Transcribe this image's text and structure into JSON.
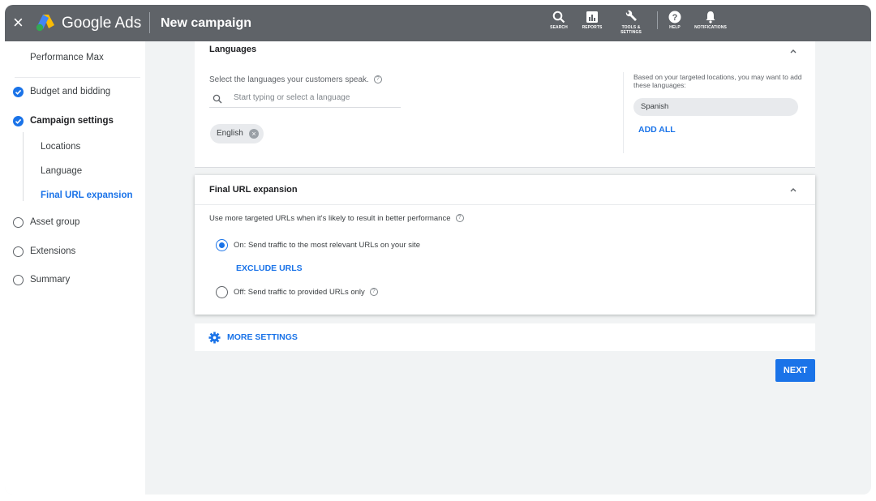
{
  "header": {
    "close_glyph": "×",
    "brand": "Google Ads",
    "title": "New campaign",
    "tools": [
      {
        "label": "SEARCH",
        "icon": "search-icon"
      },
      {
        "label": "REPORTS",
        "icon": "reports-icon"
      },
      {
        "label": "TOOLS &",
        "label2": "SETTINGS",
        "icon": "wrench-icon"
      },
      {
        "label": "HELP",
        "icon": "help-icon"
      },
      {
        "label": "NOTIFICATIONS",
        "icon": "bell-icon"
      }
    ]
  },
  "sidebar": {
    "items": [
      {
        "label": "Performance Max",
        "state": "none"
      },
      {
        "label": "Budget and bidding",
        "state": "done"
      },
      {
        "label": "Campaign settings",
        "state": "done"
      },
      {
        "label": "Locations",
        "state": "sub"
      },
      {
        "label": "Language",
        "state": "sub"
      },
      {
        "label": "Final URL expansion",
        "state": "sub-active"
      },
      {
        "label": "Asset group",
        "state": "todo"
      },
      {
        "label": "Extensions",
        "state": "todo"
      },
      {
        "label": "Summary",
        "state": "todo"
      }
    ]
  },
  "languages": {
    "title": "Languages",
    "prompt": "Select the languages your customers speak.",
    "placeholder": "Start typing or select a language",
    "chips": [
      "English"
    ],
    "suggest_text": "Based on your targeted locations, you may want to add these languages:",
    "suggestions": [
      "Spanish"
    ],
    "add_all": "ADD ALL"
  },
  "final_url": {
    "title": "Final URL expansion",
    "description": "Use more targeted URLs when it's likely to result in better performance",
    "option_on": "On: Send traffic to the most relevant URLs on your site",
    "exclude": "EXCLUDE URLS",
    "option_off": "Off: Send traffic to provided URLs only",
    "selected": "on"
  },
  "more_settings": "MORE SETTINGS",
  "next_label": "NEXT",
  "colors": {
    "accent": "#1a73e8",
    "topbar": "#5f6368",
    "page_bg": "#f1f3f4"
  }
}
